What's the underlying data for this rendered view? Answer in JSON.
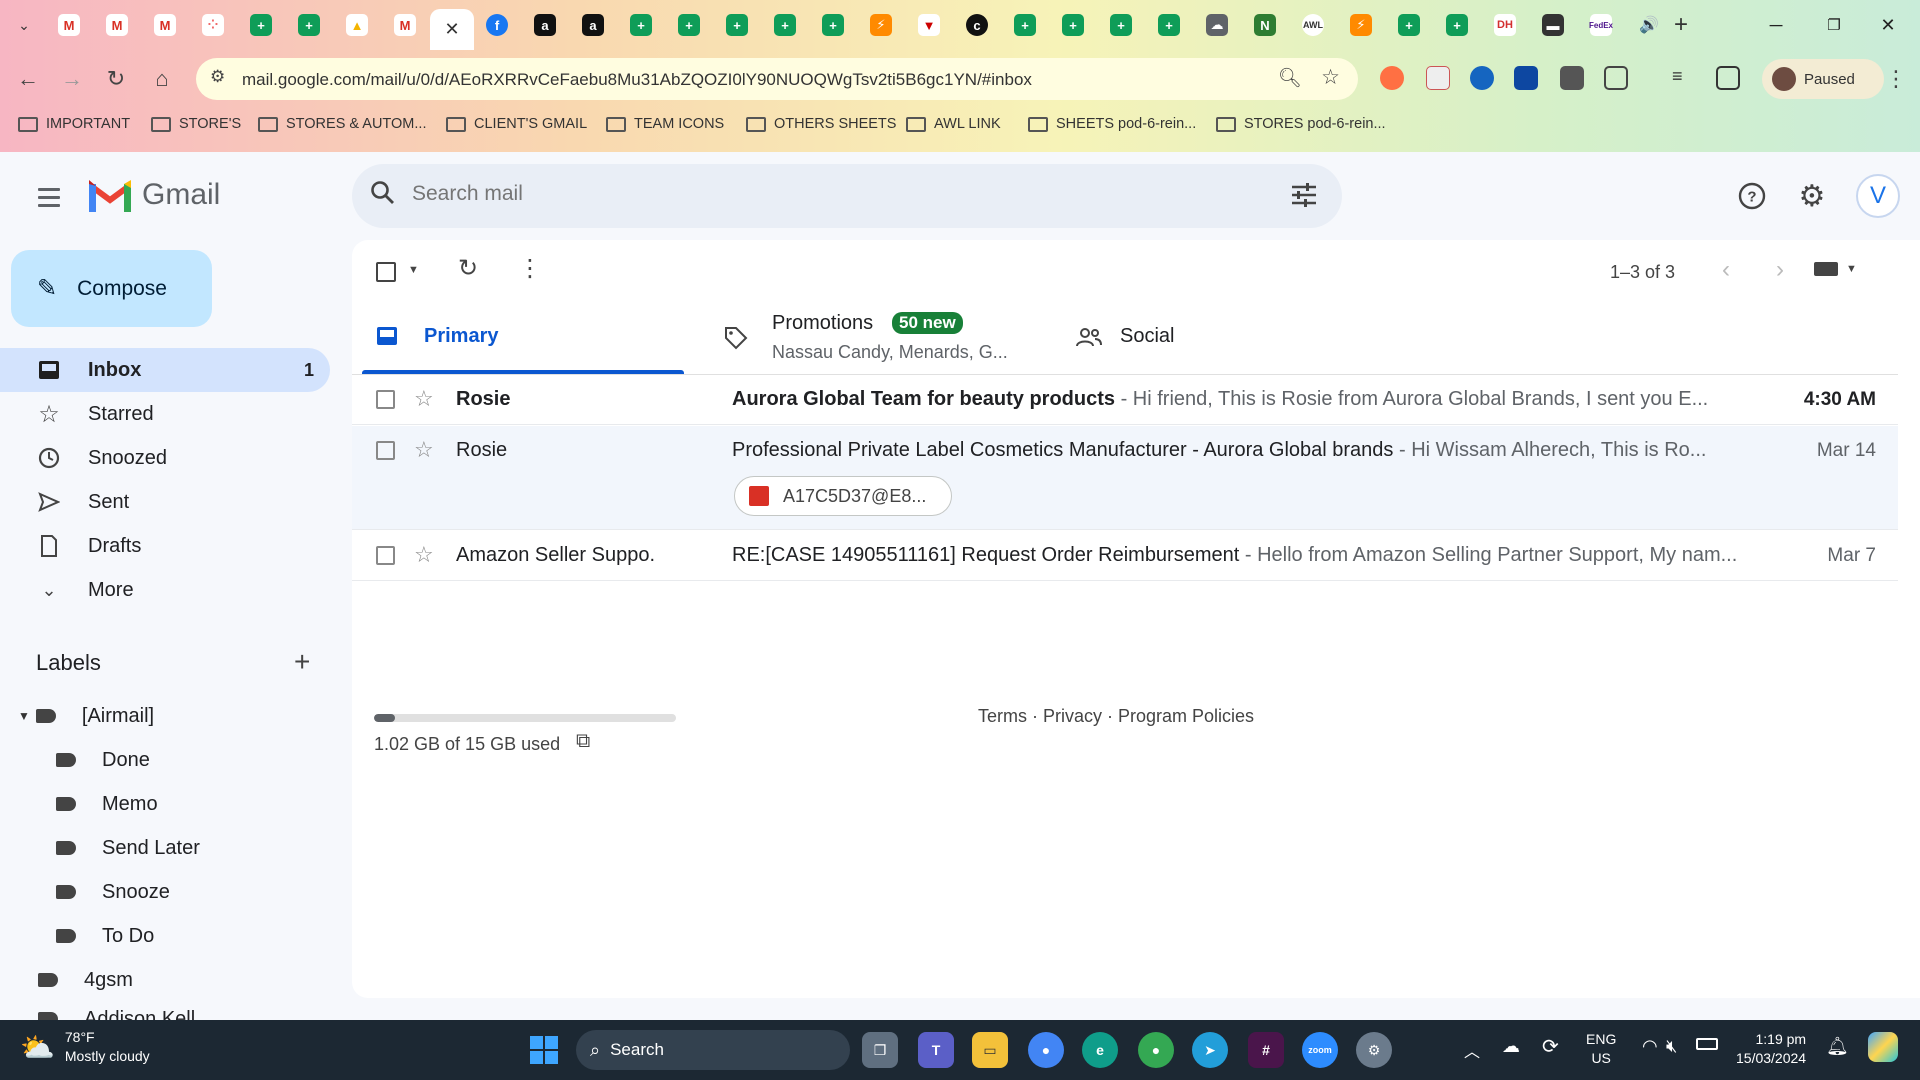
{
  "browser": {
    "url": "mail.google.com/mail/u/0/d/AEoRXRRvCeFaebu8Mu31AbZQOZI0lY90NUOQWgTsv2ti5B6gc1YN/#inbox",
    "profile_status": "Paused",
    "bookmarks": [
      "IMPORTANT",
      "STORE'S",
      "STORES & AUTOM...",
      "CLIENT'S GMAIL",
      "TEAM ICONS",
      "OTHERS SHEETS",
      "AWL LINK",
      "SHEETS pod-6-rein...",
      "STORES pod-6-rein..."
    ]
  },
  "gmail": {
    "logo_text": "Gmail",
    "search_placeholder": "Search mail",
    "avatar_letter": "V",
    "compose_label": "Compose",
    "nav": [
      {
        "label": "Inbox",
        "count": "1",
        "icon": "inbox-icon"
      },
      {
        "label": "Starred",
        "count": "",
        "icon": "star-icon"
      },
      {
        "label": "Snoozed",
        "count": "",
        "icon": "clock-icon"
      },
      {
        "label": "Sent",
        "count": "",
        "icon": "send-icon"
      },
      {
        "label": "Drafts",
        "count": "",
        "icon": "draft-icon"
      },
      {
        "label": "More",
        "count": "",
        "icon": "chevron-down-icon"
      }
    ],
    "labels_title": "Labels",
    "labels": [
      "[Airmail]",
      "Done",
      "Memo",
      "Send Later",
      "Snooze",
      "To Do",
      "4gsm",
      "Addison Kell..."
    ],
    "pagination": "1–3 of 3",
    "tabs": {
      "primary": "Primary",
      "promotions": "Promotions",
      "promotions_badge": "50 new",
      "promotions_sub": "Nassau Candy, Menards, G...",
      "social": "Social"
    },
    "emails": [
      {
        "sender": "Rosie",
        "subject": "Aurora Global Team for beauty products",
        "snippet": " - Hi friend, This is Rosie from Aurora Global Brands, I sent you E...",
        "date": "4:30 AM",
        "unread": true
      },
      {
        "sender": "Rosie",
        "subject": "Professional Private Label Cosmetics Manufacturer - Aurora Global brands",
        "snippet": " - Hi Wissam Alherech,  This is Ro...",
        "date": "Mar 14",
        "unread": false,
        "attachment": "A17C5D37@E8..."
      },
      {
        "sender": "Amazon Seller Suppo.",
        "subject": "RE:[CASE 14905511161] Request Order Reimbursement",
        "snippet": " - Hello from Amazon Selling Partner Support, My nam...",
        "date": "Mar 7",
        "unread": false
      }
    ],
    "storage_text": "1.02 GB of 15 GB used",
    "storage_fraction": 0.068,
    "footer_links": "Terms · Privacy · Program Policies"
  },
  "taskbar": {
    "weather_temp": "78°F",
    "weather_desc": "Mostly cloudy",
    "search_label": "Search",
    "lang_line1": "ENG",
    "lang_line2": "US",
    "time": "1:19 pm",
    "date": "15/03/2024"
  },
  "colors": {
    "compose_bg": "#c2e7ff",
    "selected_nav": "#d3e3fd",
    "primary_blue": "#0b57d0",
    "badge_green": "#188038"
  }
}
